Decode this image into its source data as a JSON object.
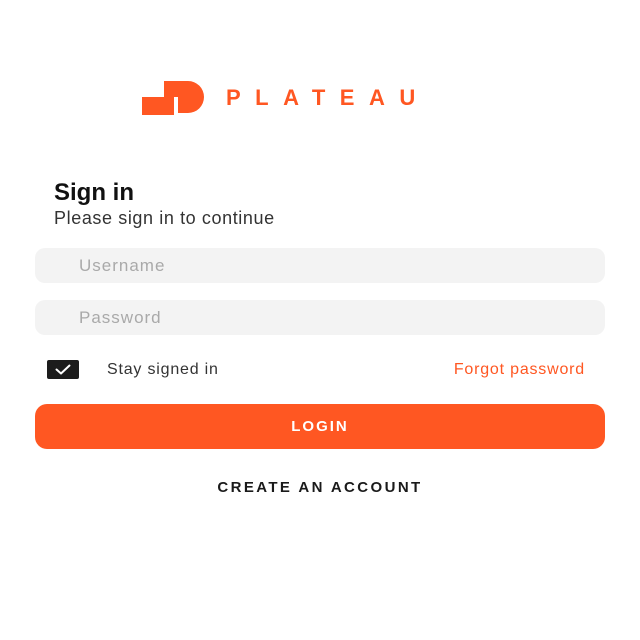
{
  "brand": {
    "name": "PLATEAU",
    "accent_color": "#ff5722",
    "logo_icon": "plateau-logo-icon"
  },
  "signin": {
    "title": "Sign in",
    "subtitle": "Please sign in to continue"
  },
  "form": {
    "username": {
      "placeholder": "Username",
      "value": ""
    },
    "password": {
      "placeholder": "Password",
      "value": ""
    },
    "stay_signed_in": {
      "label": "Stay signed in",
      "checked": true,
      "icon": "checkmark-icon"
    },
    "forgot_password_label": "Forgot password",
    "login_label": "LOGIN"
  },
  "create_account_label": "CREATE AN ACCOUNT"
}
